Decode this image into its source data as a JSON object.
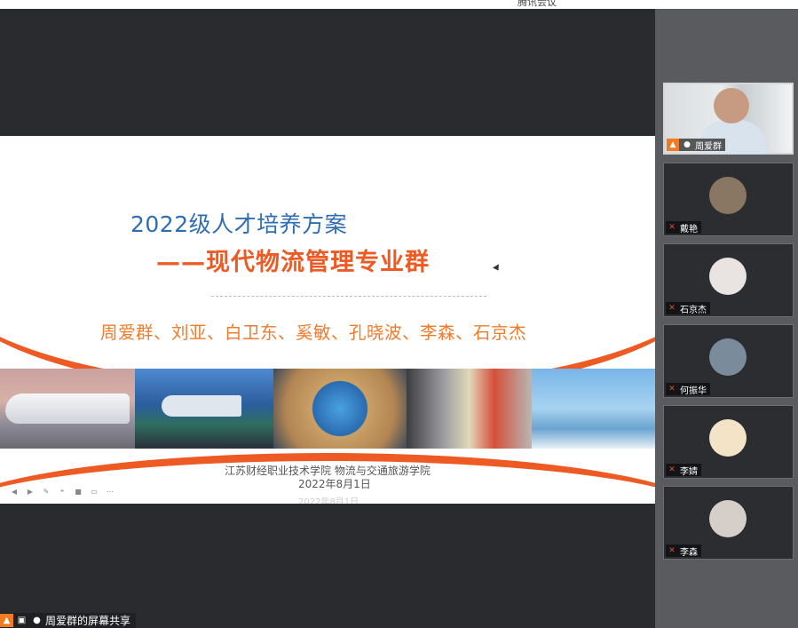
{
  "window": {
    "title": "腾讯会议"
  },
  "slide": {
    "title_line1": "2022级人才培养方案",
    "title_line2": "——现代物流管理专业群",
    "authors": "周爱群、刘亚、白卫东、奚敏、孔晓波、李森、石京杰",
    "organization": "江苏财经职业技术学院   物流与交通旅游学院",
    "date": "2022年8月1日",
    "date_ghost": "2022年8月1日",
    "accent_color": "#ee5a24",
    "title_color": "#2f6db3",
    "photos": [
      "high-speed-train",
      "airplane",
      "logistics-globe-boxes",
      "subway-train",
      "world-travel-globe"
    ],
    "toolbar_icons": [
      "prev-icon",
      "play-icon",
      "pen-icon",
      "focus-icon",
      "camera-icon",
      "subtitle-icon",
      "more-icon"
    ]
  },
  "share": {
    "label": "周爱群的屏幕共享",
    "icons": [
      "person-icon",
      "screen-share-icon",
      "mic-icon"
    ]
  },
  "participants": [
    {
      "name": "周爱群",
      "mode": "video",
      "mic": "on"
    },
    {
      "name": "戴艳",
      "mode": "avatar",
      "mic": "muted",
      "avatar_color": "#8a7763"
    },
    {
      "name": "石京杰",
      "mode": "avatar",
      "mic": "muted",
      "avatar_color": "#e9e3e1"
    },
    {
      "name": "何振华",
      "mode": "avatar",
      "mic": "muted",
      "avatar_color": "#7a8b9c"
    },
    {
      "name": "李婧",
      "mode": "avatar",
      "mic": "muted",
      "avatar_color": "#f4e4c7"
    },
    {
      "name": "李森",
      "mode": "avatar",
      "mic": "muted",
      "avatar_color": "#d6cec9"
    }
  ]
}
